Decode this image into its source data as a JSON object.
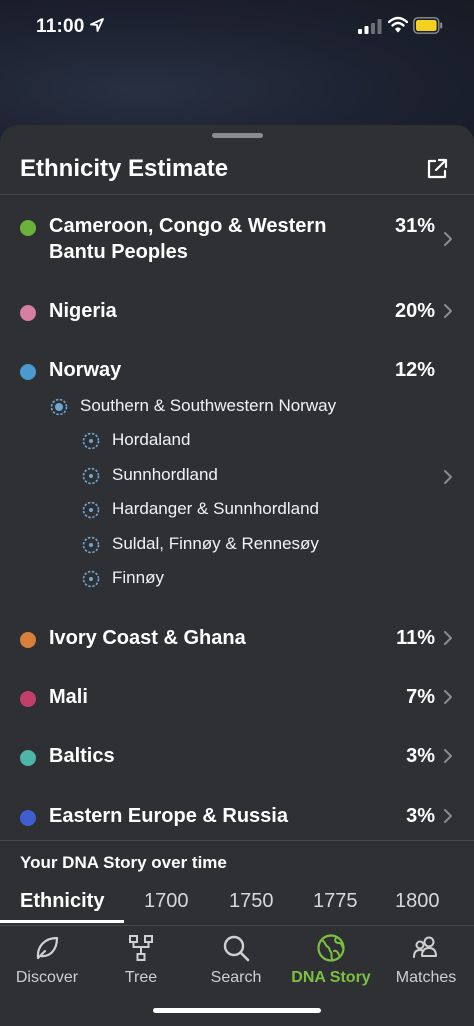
{
  "status": {
    "time": "11:00"
  },
  "sheet": {
    "title": "Ethnicity Estimate"
  },
  "regions": [
    {
      "label": "Cameroon, Congo & Western Bantu Peoples",
      "percent": "31%",
      "color": "#6bb23a"
    },
    {
      "label": "Nigeria",
      "percent": "20%",
      "color": "#d77fa0"
    },
    {
      "label": "Norway",
      "percent": "12%",
      "color": "#4a9ad0"
    },
    {
      "label": "Ivory Coast & Ghana",
      "percent": "11%",
      "color": "#d9803a"
    },
    {
      "label": "Mali",
      "percent": "7%",
      "color": "#c23f6a"
    },
    {
      "label": "Baltics",
      "percent": "3%",
      "color": "#4fb5a7"
    },
    {
      "label": "Eastern Europe & Russia",
      "percent": "3%",
      "color": "#3f5fd0"
    }
  ],
  "norway_sub": {
    "region": "Southern & Southwestern Norway",
    "communities": [
      "Hordaland",
      "Sunnhordland",
      "Hardanger & Sunnhordland",
      "Suldal, Finnøy & Rennesøy",
      "Finnøy"
    ]
  },
  "over_time": {
    "title": "Your DNA Story over time",
    "tabs": [
      "Ethnicity",
      "1700",
      "1750",
      "1775",
      "1800"
    ],
    "active": "Ethnicity"
  },
  "nav": [
    {
      "label": "Discover",
      "icon": "leaf-icon"
    },
    {
      "label": "Tree",
      "icon": "tree-icon"
    },
    {
      "label": "Search",
      "icon": "search-icon"
    },
    {
      "label": "DNA Story",
      "icon": "globe-icon"
    },
    {
      "label": "Matches",
      "icon": "people-icon"
    }
  ],
  "nav_active": "DNA Story",
  "colors": {
    "accent": "#7cc043",
    "sheet_bg": "#2f3033"
  }
}
